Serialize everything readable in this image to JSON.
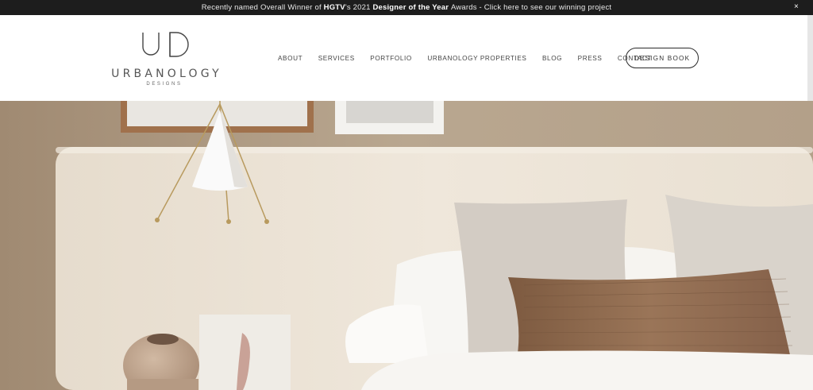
{
  "announcement": {
    "prefix": "Recently named Overall Winner of ",
    "brand": "HGTV",
    "mid": "'s 2021 ",
    "award": "Designer of the Year",
    "suffix": " Awards - Click here to see our winning project",
    "close": "×"
  },
  "logo": {
    "monogram": "UD",
    "name": "URBANOLOGY",
    "sub": "DESIGNS"
  },
  "nav": {
    "items": [
      "ABOUT",
      "SERVICES",
      "PORTFOLIO",
      "URBANOLOGY PROPERTIES",
      "BLOG",
      "PRESS",
      "CONTACT"
    ],
    "cta": "DESIGN BOOK"
  },
  "hero": {
    "icons": [
      "pendant-lamp-icon",
      "vase-icon"
    ],
    "colors": {
      "wall": "#b8a58f",
      "headboard": "#efe7db",
      "pillow_grey": "#d6d0c8",
      "pillow_brown": "#8e6a4f",
      "sheet": "#f7f5f2"
    }
  }
}
